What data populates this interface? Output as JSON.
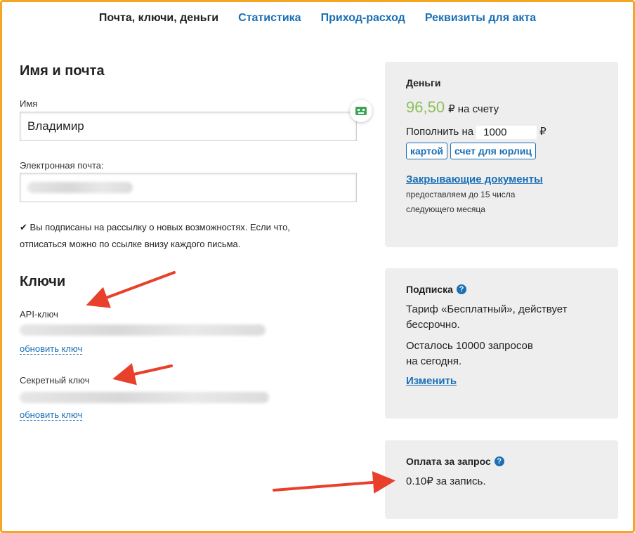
{
  "tabs": [
    {
      "label": "Почта, ключи, деньги"
    },
    {
      "label": "Статистика"
    },
    {
      "label": "Приход-расход"
    },
    {
      "label": "Реквизиты для акта"
    }
  ],
  "profile": {
    "heading": "Имя и почта",
    "name_label": "Имя",
    "name_value": "Владимир",
    "email_label": "Электронная почта:",
    "subscription_note_line1": "Вы подписаны на рассылку о новых возможностях. Если что,",
    "subscription_note_line2": "отписаться можно по ссылке внизу каждого письма."
  },
  "keys": {
    "heading": "Ключи",
    "api_label": "API-ключ",
    "api_refresh": "обновить ключ",
    "secret_label": "Секретный ключ",
    "secret_refresh": "обновить ключ"
  },
  "money": {
    "title": "Деньги",
    "balance": "96,50",
    "balance_suffix": "₽ на счету",
    "topup_label": "Пополнить на",
    "topup_value": "1000",
    "currency": "₽",
    "card_button": "картой",
    "invoice_button": "счет для юрлиц",
    "docs_link": "Закрывающие документы",
    "docs_note_line1": "предоставляем до 15 числа",
    "docs_note_line2": "следующего месяца"
  },
  "subscription": {
    "title": "Подписка",
    "tariff_line1": "Тариф «Бесплатный», действует",
    "tariff_line2": "бессрочно.",
    "remaining_line1": "Осталось 10000 запросов",
    "remaining_line2": "на сегодня.",
    "change_link": "Изменить"
  },
  "per_request": {
    "title": "Оплата за запрос",
    "price": "0.10₽ за запись."
  },
  "colors": {
    "accent": "#1a6fb5",
    "balance": "#8dbf5a",
    "arrow": "#e8402a",
    "frame": "#f5a623"
  },
  "icons": {
    "help": "?",
    "check": "✔"
  }
}
